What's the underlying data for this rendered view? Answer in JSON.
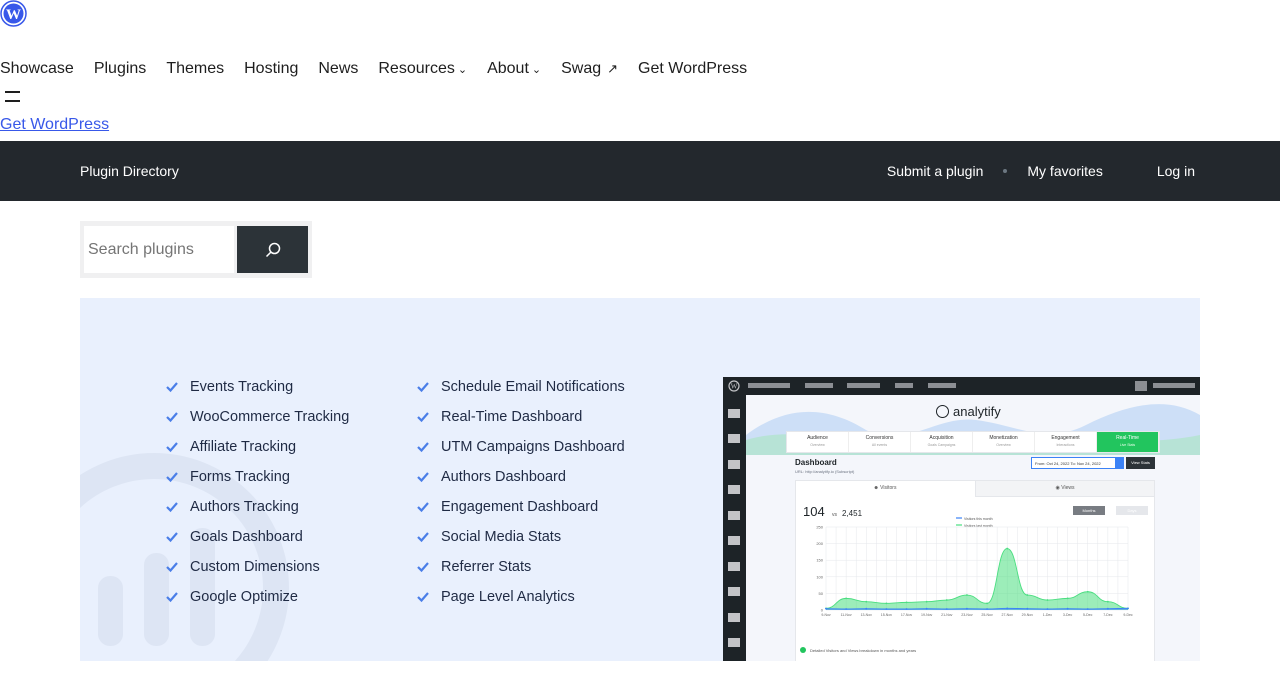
{
  "global_nav": {
    "logo_icon": "wordpress-logo-icon",
    "items": [
      {
        "label": "Showcase",
        "dropdown": false,
        "external": false
      },
      {
        "label": "Plugins",
        "dropdown": false,
        "external": false
      },
      {
        "label": "Themes",
        "dropdown": false,
        "external": false
      },
      {
        "label": "Hosting",
        "dropdown": false,
        "external": false
      },
      {
        "label": "News",
        "dropdown": false,
        "external": false
      },
      {
        "label": "Resources",
        "dropdown": true,
        "external": false
      },
      {
        "label": "About",
        "dropdown": true,
        "external": false
      },
      {
        "label": "Swag",
        "dropdown": false,
        "external": true
      },
      {
        "label": "Get WordPress",
        "dropdown": false,
        "external": false
      }
    ],
    "menu_icon": "hamburger-menu-icon",
    "get_wordpress_link": "Get WordPress",
    "link_color": "#3858e9"
  },
  "directory_bar": {
    "title": "Plugin Directory",
    "submit_label": "Submit a plugin",
    "favorites_label": "My favorites",
    "login_label": "Log in",
    "background": "#23282d"
  },
  "search": {
    "placeholder": "Search plugins",
    "value": "",
    "button_icon": "search-icon"
  },
  "banner": {
    "background": "#e9f0fd",
    "check_color": "#4a7ee8",
    "features_left": [
      "Events Tracking",
      "WooCommerce Tracking",
      "Affiliate Tracking",
      "Forms Tracking",
      "Authors Tracking",
      "Goals Dashboard",
      "Custom Dimensions",
      "Google Optimize"
    ],
    "features_right": [
      "Schedule Email Notifications",
      "Real-Time Dashboard",
      "UTM Campaigns Dashboard",
      "Authors Dashboard",
      "Engagement Dashboard",
      "Social Media Stats",
      "Referrer Stats",
      "Page Level Analytics"
    ]
  },
  "screenshot": {
    "brand": "analytify",
    "tabs": [
      {
        "label": "Audience",
        "sub": "Overview"
      },
      {
        "label": "Conversions",
        "sub": "All events"
      },
      {
        "label": "Acquisition",
        "sub": "Goals Campaigns"
      },
      {
        "label": "Monetization",
        "sub": "Overview"
      },
      {
        "label": "Engagement",
        "sub": "Interactions"
      },
      {
        "label": "Real-Time",
        "sub": "Live Stats",
        "active": true
      }
    ],
    "dashboard_title": "Dashboard",
    "dashboard_url": "URL: http://analytify.io (Subscript)",
    "date_range": "From: Oct 24, 2022   To: Nov 24, 2022",
    "view_stats": "View Stats",
    "tab_visitors": "Visitors",
    "tab_views": "Views",
    "visitors_count": "104",
    "vs_label": "vs",
    "compare_count": "2,451",
    "months_button": "Months",
    "days_button": "Days",
    "legend_this_month": "Visitors this month",
    "legend_last_month": "Visitors last month",
    "footnote": "Detailed Visitors and Views breakdown in months and years",
    "accent_green": "#22c55e",
    "accent_blue": "#3b82f6"
  },
  "chart_data": {
    "type": "area",
    "x": [
      "9-Nov",
      "11-Nov",
      "13-Nov",
      "15-Nov",
      "17-Nov",
      "19-Nov",
      "21-Nov",
      "23-Nov",
      "25-Nov",
      "27-Nov",
      "29-Nov",
      "1-Dec",
      "3-Dec",
      "5-Dec",
      "7-Dec",
      "9-Dec"
    ],
    "y_ticks": [
      0,
      50,
      100,
      150,
      200,
      250
    ],
    "ylim": [
      0,
      250
    ],
    "series": [
      {
        "name": "Visitors last month",
        "color": "#4ade80",
        "values": [
          5,
          35,
          25,
          20,
          23,
          25,
          30,
          45,
          20,
          185,
          45,
          30,
          35,
          55,
          25,
          5
        ]
      },
      {
        "name": "Visitors this month",
        "color": "#3b82f6",
        "values": [
          4,
          3,
          4,
          3,
          3,
          4,
          3,
          4,
          3,
          5,
          4,
          3,
          4,
          3,
          4,
          5
        ]
      }
    ]
  }
}
